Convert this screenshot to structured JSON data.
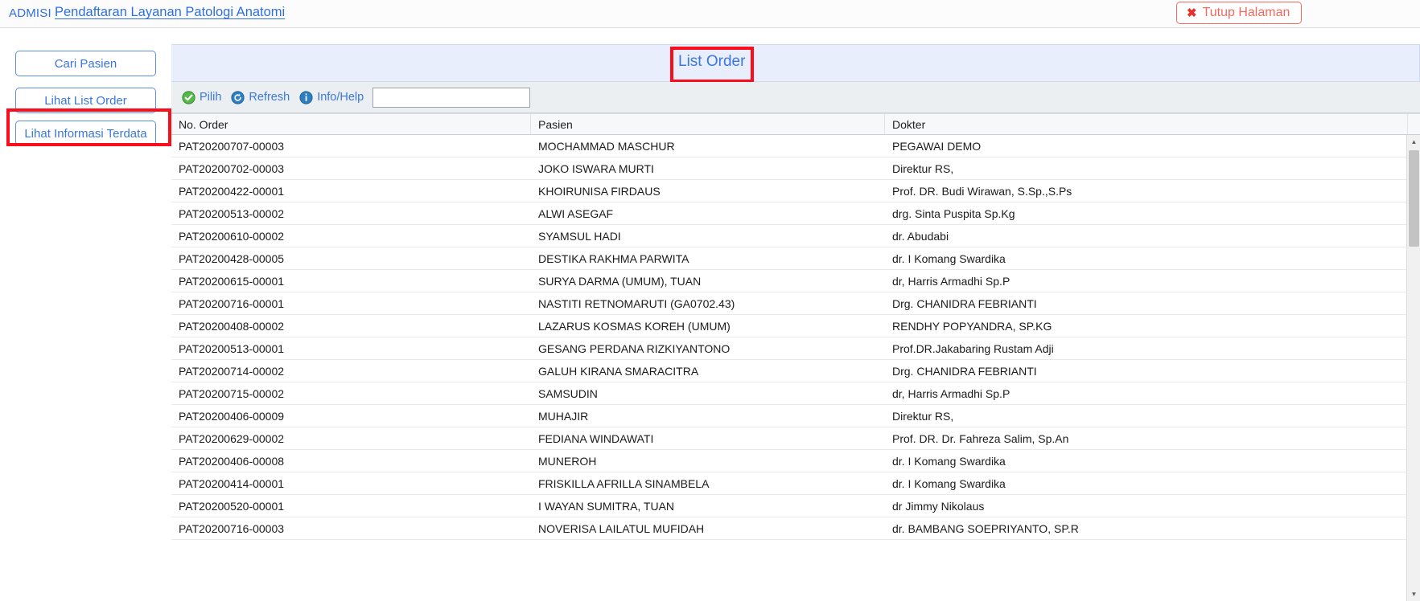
{
  "topbar": {
    "module": "ADMISI",
    "page_link": "Pendaftaran Layanan Patologi Anatomi",
    "close_button": "Tutup Halaman",
    "close_icon": "close-x-icon"
  },
  "sidebar": {
    "buttons": [
      {
        "label": "Cari Pasien"
      },
      {
        "label": "Lihat List Order",
        "highlighted": true
      },
      {
        "label": "Lihat Informasi Terdata"
      }
    ]
  },
  "main": {
    "title": "List Order",
    "title_highlighted": true,
    "toolbar": {
      "items": [
        {
          "label": "Pilih",
          "icon": "check-circle-icon",
          "color": "#55b947"
        },
        {
          "label": "Refresh",
          "icon": "refresh-circle-icon",
          "color": "#2d7fc1"
        },
        {
          "label": "Info/Help",
          "icon": "info-circle-icon",
          "color": "#2d7fc1"
        }
      ],
      "search_value": "",
      "search_placeholder": ""
    },
    "table": {
      "columns": [
        "No. Order",
        "Pasien",
        "Dokter"
      ],
      "rows": [
        [
          "PAT20200707-00003",
          "MOCHAMMAD MASCHUR",
          "PEGAWAI DEMO"
        ],
        [
          "PAT20200702-00003",
          "JOKO ISWARA MURTI",
          "Direktur RS,"
        ],
        [
          "PAT20200422-00001",
          "KHOIRUNISA FIRDAUS",
          "Prof. DR. Budi Wirawan, S.Sp.,S.Ps"
        ],
        [
          "PAT20200513-00002",
          "ALWI ASEGAF",
          "drg. Sinta Puspita Sp.Kg"
        ],
        [
          "PAT20200610-00002",
          "SYAMSUL HADI",
          "dr. Abudabi"
        ],
        [
          "PAT20200428-00005",
          "DESTIKA RAKHMA PARWITA",
          "dr. I Komang Swardika"
        ],
        [
          "PAT20200615-00001",
          "SURYA DARMA (UMUM), TUAN",
          "dr, Harris Armadhi Sp.P"
        ],
        [
          "PAT20200716-00001",
          "NASTITI RETNOMARUTI (GA0702.43)",
          "Drg. CHANIDRA FEBRIANTI"
        ],
        [
          "PAT20200408-00002",
          "LAZARUS KOSMAS KOREH (UMUM)",
          "RENDHY POPYANDRA, SP.KG"
        ],
        [
          "PAT20200513-00001",
          "GESANG PERDANA RIZKIYANTONO",
          "Prof.DR.Jakabaring Rustam Adji"
        ],
        [
          "PAT20200714-00002",
          "GALUH KIRANA SMARACITRA",
          "Drg. CHANIDRA FEBRIANTI"
        ],
        [
          "PAT20200715-00002",
          "SAMSUDIN",
          "dr, Harris Armadhi Sp.P"
        ],
        [
          "PAT20200406-00009",
          "MUHAJIR",
          "Direktur RS,"
        ],
        [
          "PAT20200629-00002",
          "FEDIANA WINDAWATI",
          "Prof. DR. Dr. Fahreza Salim, Sp.An"
        ],
        [
          "PAT20200406-00008",
          "MUNEROH",
          "dr. I Komang Swardika"
        ],
        [
          "PAT20200414-00001",
          "FRISKILLA AFRILLA SINAMBELA",
          "dr. I Komang Swardika"
        ],
        [
          "PAT20200520-00001",
          "I WAYAN SUMITRA, TUAN",
          "dr Jimmy Nikolaus"
        ],
        [
          "PAT20200716-00003",
          "NOVERISA LAILATUL MUFIDAH",
          "dr. BAMBANG SOEPRIYANTO, SP.R"
        ]
      ]
    },
    "scrollbar": {
      "up_arrow": "▲",
      "down_arrow": "▼"
    }
  },
  "colors": {
    "link_blue": "#2f6fdd",
    "annotation_red": "#fc0d1b",
    "close_red": "#f4685d",
    "title_band": "#e8eefb"
  }
}
